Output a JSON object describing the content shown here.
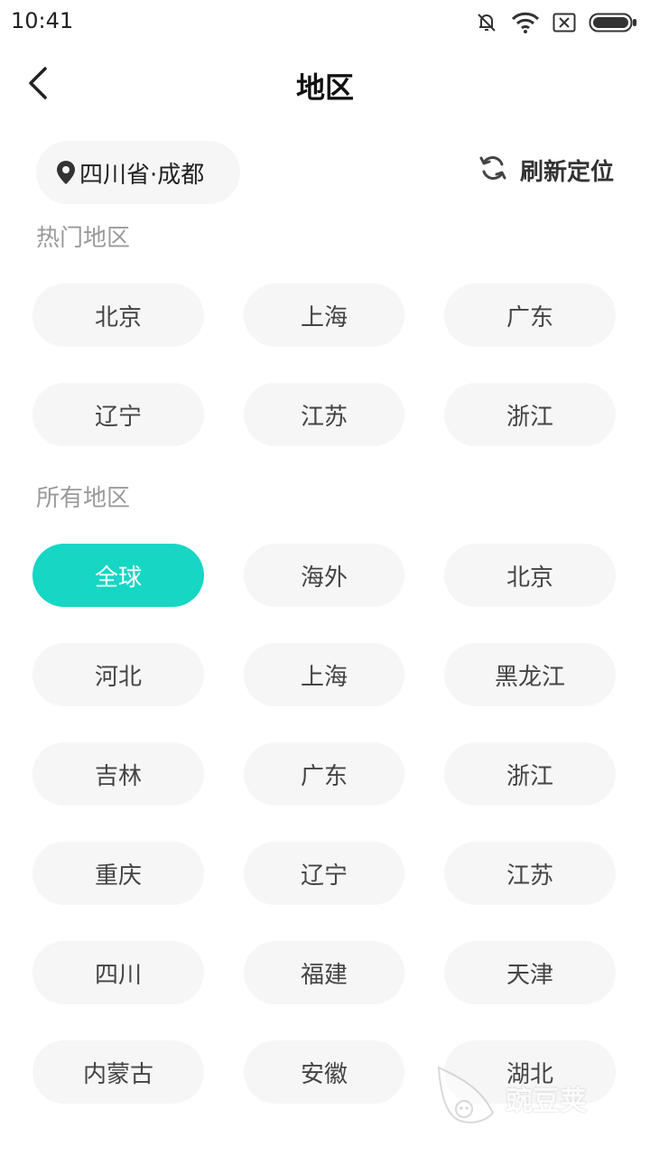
{
  "status_bar": {
    "time": "10:41",
    "icons": [
      "mute-bell-icon",
      "wifi-icon",
      "sim-icon",
      "battery-icon"
    ]
  },
  "header": {
    "title": "地区",
    "back_icon": "chevron-left-icon"
  },
  "location": {
    "current": "四川省·成都",
    "icon": "location-pin-icon",
    "refresh_label": "刷新定位",
    "refresh_icon": "refresh-icon"
  },
  "hot_regions": {
    "title": "热门地区",
    "items": [
      "北京",
      "上海",
      "广东",
      "辽宁",
      "江苏",
      "浙江"
    ]
  },
  "all_regions": {
    "title": "所有地区",
    "selected": "全球",
    "items": [
      "全球",
      "海外",
      "北京",
      "河北",
      "上海",
      "黑龙江",
      "吉林",
      "广东",
      "浙江",
      "重庆",
      "辽宁",
      "江苏",
      "四川",
      "福建",
      "天津",
      "内蒙古",
      "安徽",
      "湖北"
    ]
  },
  "colors": {
    "accent": "#16d6c4",
    "chip_bg": "#f6f6f6",
    "section_title": "#9a9a9a"
  },
  "watermark": {
    "text": "豌豆荚"
  }
}
